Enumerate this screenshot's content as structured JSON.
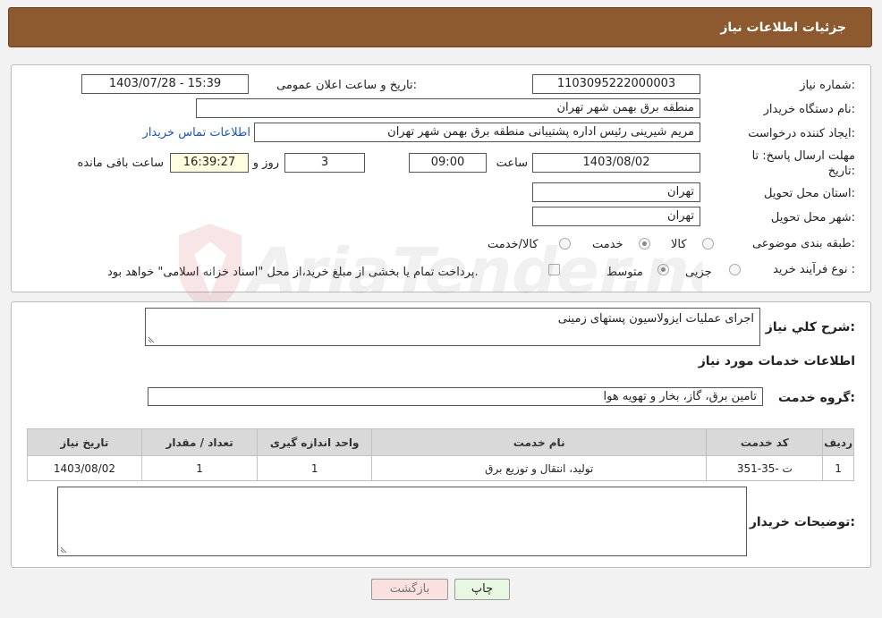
{
  "header": {
    "title": "جزئیات اطلاعات نیاز"
  },
  "fields": {
    "need_number_label": "شماره نیاز:",
    "need_number": "1103095222000003",
    "announce_label": "تاریخ و ساعت اعلان عمومی:",
    "announce_value": "1403/07/28 - 15:39",
    "buyer_org_label": "نام دستگاه خریدار:",
    "buyer_org": "منطقه برق بهمن شهر تهران",
    "requester_label": "ایجاد کننده درخواست:",
    "requester": "مریم شیرینی رئیس اداره پشتیبانی منطقه برق بهمن شهر تهران",
    "contact_link": "اطلاعات تماس خریدار",
    "deadline_label_1": "مهلت ارسال پاسخ: تا",
    "deadline_label_2": "تاریخ:",
    "deadline_date": "1403/08/02",
    "time_label": "ساعت",
    "deadline_time": "09:00",
    "days_value": "3",
    "days_label": "روز و",
    "remaining_time": "16:39:27",
    "remaining_label": "ساعت باقی مانده",
    "province_label": "استان محل تحویل:",
    "province": "تهران",
    "city_label": "شهر محل تحویل:",
    "city": "تهران",
    "category_label": "طبقه بندی موضوعی:",
    "category_options": [
      "کالا",
      "خدمت",
      "کالا/خدمت"
    ],
    "category_selected": "خدمت",
    "process_label": "نوع فرآیند خرید :",
    "process_options": [
      "جزیی",
      "متوسط"
    ],
    "process_selected": "متوسط",
    "payment_note": "پرداخت تمام یا بخشی از مبلغ خرید،از محل \"اسناد خزانه اسلامی\" خواهد بود."
  },
  "summary": {
    "label": "شرح کلي نياز:",
    "text": "اجرای عملیات ایزولاسیون پستهای زمینی"
  },
  "services": {
    "section_title": "اطلاعات خدمات مورد نیاز",
    "group_label": "گروه خدمت:",
    "group_value": "تامین برق، گاز، بخار و تهویه هوا",
    "columns": [
      "ردیف",
      "کد خدمت",
      "نام خدمت",
      "واحد اندازه گیری",
      "تعداد / مقدار",
      "تاریخ نیاز"
    ],
    "rows": [
      [
        "1",
        "ت -35-351",
        "تولید، انتقال و توزیع برق",
        "1",
        "1",
        "1403/08/02"
      ]
    ]
  },
  "buyer_notes": {
    "label": "توضیحات خریدار:",
    "text": ""
  },
  "buttons": {
    "print": "چاپ",
    "back": "بازگشت"
  },
  "watermark": {
    "text": "AriaTender.net"
  },
  "colors": {
    "header": "#8c5a2e",
    "link": "#1a57c2",
    "print_button": "#e8f8e0",
    "back_button": "#fbe0e0"
  }
}
